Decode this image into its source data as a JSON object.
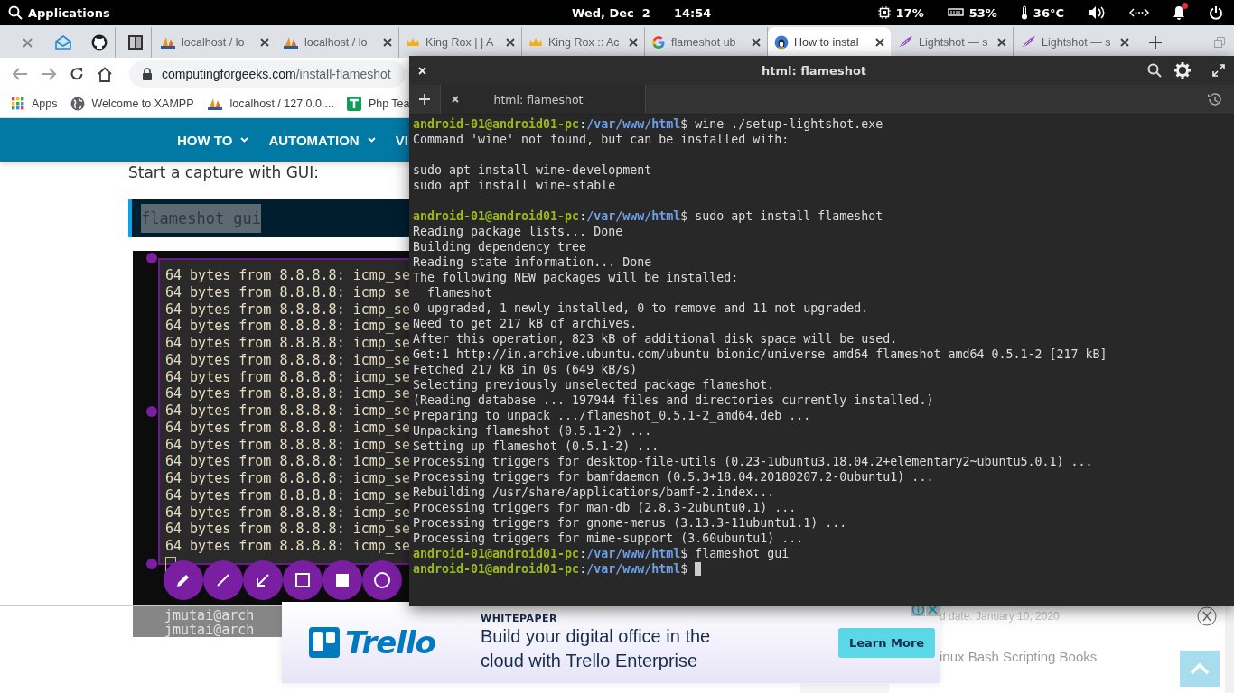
{
  "top_panel": {
    "apps_label": "Applications",
    "date": "Wed, Dec  2",
    "time": "14:54",
    "indicators": [
      {
        "kind": "cpu",
        "value": "17%"
      },
      {
        "kind": "memory",
        "value": "53%"
      },
      {
        "kind": "temperature",
        "value": "36°C"
      }
    ],
    "notifications": {
      "unread": true
    }
  },
  "browser": {
    "tabs": [
      {
        "label": "localhost / lo",
        "kind": "pma",
        "selected": false
      },
      {
        "label": "localhost / lo",
        "kind": "pma",
        "selected": false
      },
      {
        "label": "King Rox | | A",
        "kind": "crown",
        "selected": false
      },
      {
        "label": "King Rox :: Ac",
        "kind": "crown",
        "selected": false
      },
      {
        "label": "flameshot ub",
        "kind": "google",
        "selected": false
      },
      {
        "label": "How to instal",
        "kind": "site",
        "selected": true
      },
      {
        "label": "Lightshot — s",
        "kind": "feather",
        "selected": false
      },
      {
        "label": "Lightshot — s",
        "kind": "feather",
        "selected": false
      }
    ],
    "url": {
      "domain": "computingforgeeks.com",
      "path": "/install-flameshot"
    },
    "bookmarks": [
      {
        "label": "Apps",
        "kind": "apps"
      },
      {
        "label": "Welcome to XAMPP",
        "kind": "globe"
      },
      {
        "label": "localhost / 127.0.0....",
        "kind": "pma"
      },
      {
        "label": "Php Tea",
        "kind": "sheet"
      }
    ]
  },
  "page": {
    "nav": [
      {
        "label": "HOW TO",
        "kind": "menu"
      },
      {
        "label": "AUTOMATION",
        "kind": "menu"
      },
      {
        "label": "VI",
        "kind": "cut"
      }
    ],
    "intro": "Start a capture with GUI:",
    "code": "flameshot gui",
    "screenshot_lines": [
      {
        "text": "64 bytes from 8.8.8.8: icmp_se"
      },
      {
        "text": "64 bytes from 8.8.8.8: icmp_se"
      },
      {
        "text": "64 bytes from 8.8.8.8: icmp_se"
      },
      {
        "text": "64 bytes from 8.8.8.8: icmp_se"
      },
      {
        "text": "64 bytes from 8.8.8.8: icmp_se"
      },
      {
        "text": "64 bytes from 8.8.8.8: icmp_se"
      },
      {
        "text": "64 bytes from 8.8.8.8: icmp_se"
      },
      {
        "text": "64 bytes from 8.8.8.8: icmp_se"
      },
      {
        "text": "64 bytes from 8.8.8.8: icmp_se"
      },
      {
        "text": "64 bytes from 8.8.8.8: icmp_se"
      },
      {
        "text": "64 bytes from 8.8.8.8: icmp_se"
      },
      {
        "text": "64 bytes from 8.8.8.8: icmp_se"
      },
      {
        "text": "64 bytes from 8.8.8.8: icmp_se"
      },
      {
        "text": "64 bytes from 8.8.8.8: icmp_se"
      },
      {
        "text": "64 bytes from 8.8.8.8: icmp_se"
      },
      {
        "text": "64 bytes from 8.8.8.8: icmp_se"
      },
      {
        "text": "64 bytes from 8.8.8.8: icmp_se"
      }
    ],
    "screenshot_footer": [
      "jmutai@arch",
      "jmutai@arch"
    ],
    "capture_tools": [
      {
        "kind": "pencil"
      },
      {
        "kind": "line"
      },
      {
        "kind": "arrow"
      },
      {
        "kind": "rectangle"
      },
      {
        "kind": "filled-rectangle"
      },
      {
        "kind": "circle"
      }
    ],
    "sidebar": [
      {
        "date": "d date: January 10, 2020",
        "kind": "date_only"
      },
      {
        "title": "inux Bash Scripting Books",
        "kind": "title_only"
      }
    ],
    "ad": {
      "eyebrow": "WHITEPAPER",
      "brand": "Trello",
      "headline": "Build your digital office in the cloud with Trello Enterprise",
      "button": "Learn More"
    }
  },
  "terminal": {
    "title": "html: flameshot",
    "tab": "html: flameshot",
    "lines": [
      {
        "kind": "prompt",
        "user": "android-01@android01-pc",
        "sep": ":",
        "path": "/var/www/html",
        "command": "$ wine ./setup-lightshot.exe"
      },
      {
        "kind": "output",
        "text": "Command 'wine' not found, but can be installed with:"
      },
      {
        "kind": "blank"
      },
      {
        "kind": "output",
        "text": "sudo apt install wine-development"
      },
      {
        "kind": "output",
        "text": "sudo apt install wine-stable"
      },
      {
        "kind": "blank"
      },
      {
        "kind": "prompt",
        "user": "android-01@android01-pc",
        "sep": ":",
        "path": "/var/www/html",
        "command": "$ sudo apt install flameshot"
      },
      {
        "kind": "output",
        "text": "Reading package lists... Done"
      },
      {
        "kind": "output",
        "text": "Building dependency tree"
      },
      {
        "kind": "output",
        "text": "Reading state information... Done"
      },
      {
        "kind": "output",
        "text": "The following NEW packages will be installed:"
      },
      {
        "kind": "output",
        "text": "  flameshot"
      },
      {
        "kind": "output",
        "text": "0 upgraded, 1 newly installed, 0 to remove and 11 not upgraded."
      },
      {
        "kind": "output",
        "text": "Need to get 217 kB of archives."
      },
      {
        "kind": "output",
        "text": "After this operation, 823 kB of additional disk space will be used."
      },
      {
        "kind": "output",
        "text": "Get:1 http://in.archive.ubuntu.com/ubuntu bionic/universe amd64 flameshot amd64 0.5.1-2 [217 kB]"
      },
      {
        "kind": "output",
        "text": "Fetched 217 kB in 0s (649 kB/s)"
      },
      {
        "kind": "output",
        "text": "Selecting previously unselected package flameshot."
      },
      {
        "kind": "output",
        "text": "(Reading database ... 197944 files and directories currently installed.)"
      },
      {
        "kind": "output",
        "text": "Preparing to unpack .../flameshot_0.5.1-2_amd64.deb ..."
      },
      {
        "kind": "output",
        "text": "Unpacking flameshot (0.5.1-2) ..."
      },
      {
        "kind": "output",
        "text": "Setting up flameshot (0.5.1-2) ..."
      },
      {
        "kind": "output",
        "text": "Processing triggers for desktop-file-utils (0.23-1ubuntu3.18.04.2+elementary2~ubuntu5.0.1) ..."
      },
      {
        "kind": "output",
        "text": "Processing triggers for bamfdaemon (0.5.3+18.04.20180207.2-0ubuntu1) ..."
      },
      {
        "kind": "output",
        "text": "Rebuilding /usr/share/applications/bamf-2.index..."
      },
      {
        "kind": "output",
        "text": "Processing triggers for man-db (2.8.3-2ubuntu0.1) ..."
      },
      {
        "kind": "output",
        "text": "Processing triggers for gnome-menus (3.13.3-11ubuntu1.1) ..."
      },
      {
        "kind": "output",
        "text": "Processing triggers for mime-support (3.60ubuntu1) ..."
      },
      {
        "kind": "prompt",
        "user": "android-01@android01-pc",
        "sep": ":",
        "path": "/var/www/html",
        "command": "$ flameshot gui"
      },
      {
        "kind": "prompt",
        "user": "android-01@android01-pc",
        "sep": ":",
        "path": "/var/www/html",
        "command": "$",
        "cursor": true
      }
    ]
  }
}
